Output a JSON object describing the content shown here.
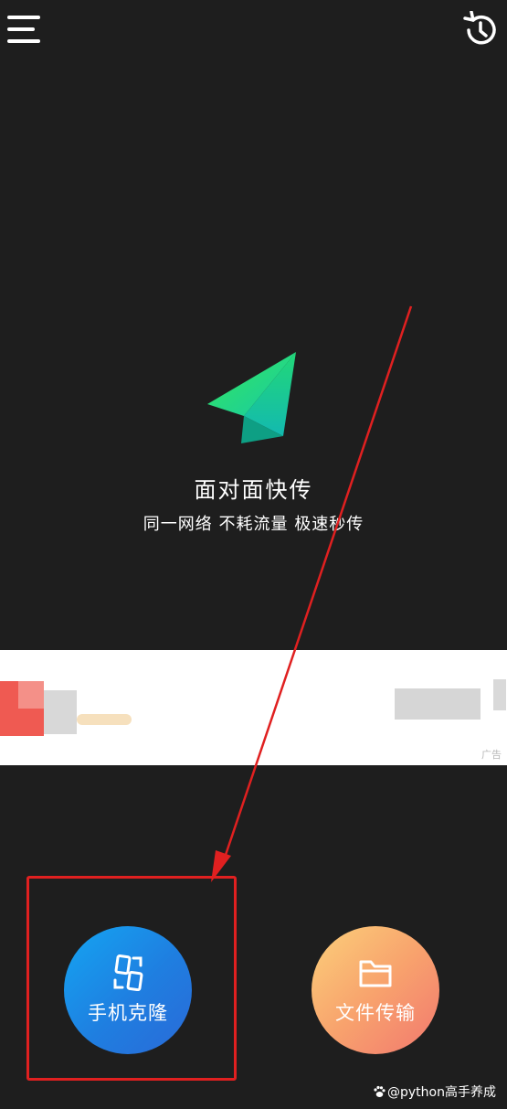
{
  "header": {
    "menu_icon": "hamburger-menu-icon",
    "history_icon": "history-icon"
  },
  "hero": {
    "icon": "paper-plane-icon",
    "title": "面对面快传",
    "subtitle": "同一网络  不耗流量  极速秒传"
  },
  "ad": {
    "label": "广告"
  },
  "actions": {
    "clone": {
      "label": "手机克隆",
      "icon": "phone-clone-icon",
      "color": "#1f7ee0"
    },
    "file": {
      "label": "文件传输",
      "icon": "folder-icon",
      "color": "#f8a36d"
    }
  },
  "annotation": {
    "color": "#e02020"
  },
  "watermark": {
    "text": "@python高手养成"
  }
}
